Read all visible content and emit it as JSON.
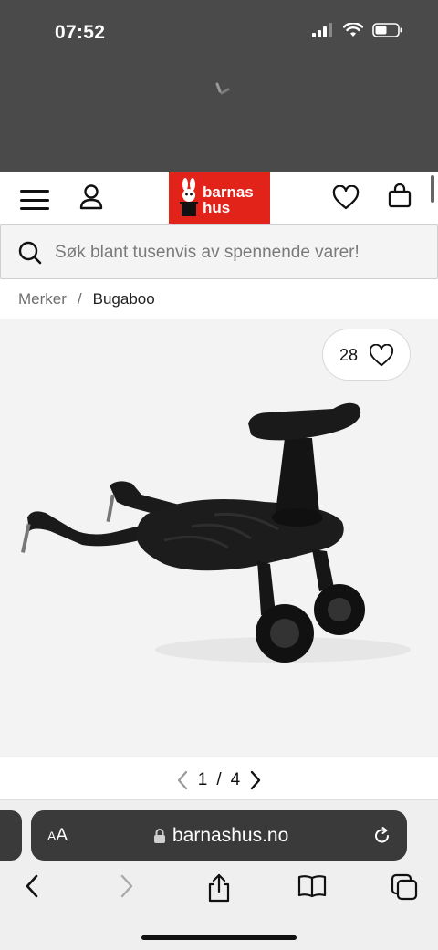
{
  "status_bar": {
    "time": "07:52"
  },
  "header": {
    "logo_line1": "barnas",
    "logo_line2": "hus",
    "brand_color": "#e2231a"
  },
  "search": {
    "placeholder": "Søk blant tusenvis av spennende varer!"
  },
  "breadcrumb": {
    "parent": "Merker",
    "separator": "/",
    "current": "Bugaboo"
  },
  "product": {
    "wishlist_count": "28",
    "image_desc_icon": "ride-on-board-icon"
  },
  "gallery": {
    "current": "1",
    "separator": "/",
    "total": "4"
  },
  "browser": {
    "text_size_label_small": "A",
    "text_size_label_large": "A",
    "url": "barnashus.no"
  }
}
